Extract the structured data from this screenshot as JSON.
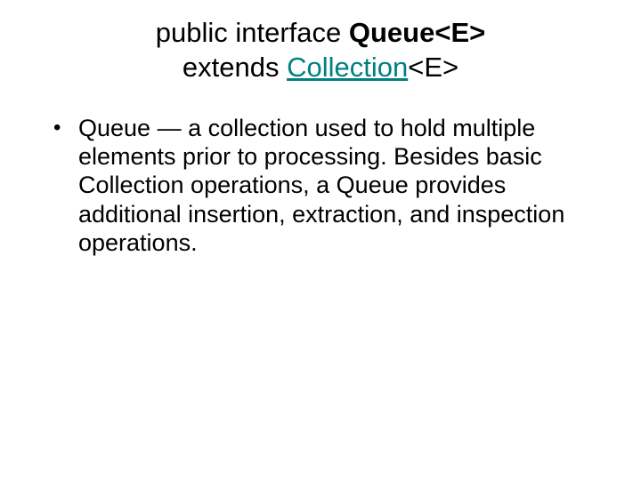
{
  "title": {
    "part1": "public interface ",
    "part2_bold": "Queue<E>",
    "part3": "extends ",
    "part4_link": "Collection",
    "part5": "<E>"
  },
  "bullets": [
    "Queue — a collection used to hold multiple elements prior to processing. Besides basic Collection operations, a Queue provides additional insertion, extraction, and inspection operations."
  ]
}
